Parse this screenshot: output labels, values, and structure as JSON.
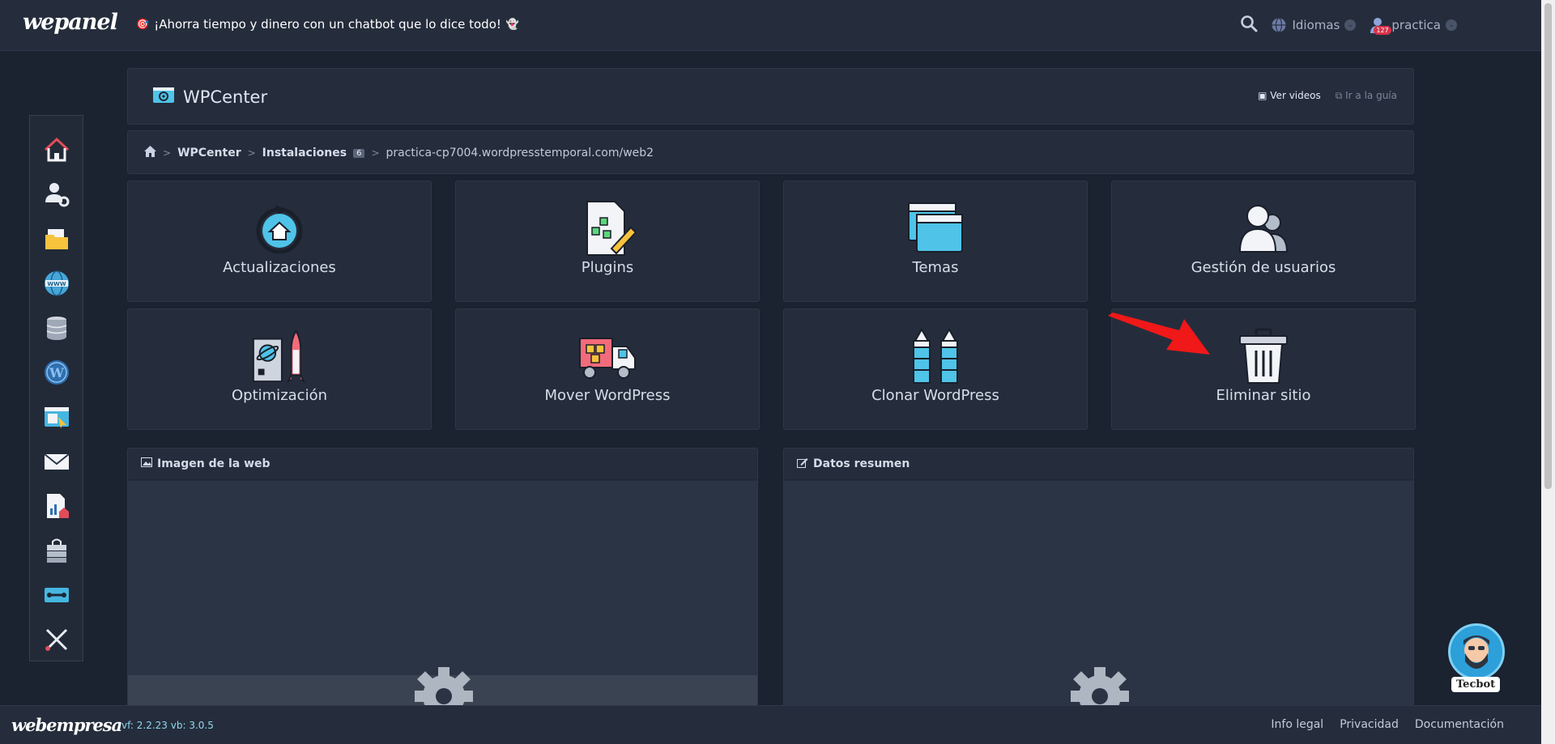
{
  "topbar": {
    "logo": "wepanel",
    "promo_text": "¡Ahorra tiempo y dinero con un chatbot que lo dice todo!",
    "languages_label": "Idiomas",
    "user_label": "practica",
    "notification_count": "127"
  },
  "header": {
    "title": "WPCenter",
    "watch_videos": "Ver videos",
    "go_to_guide": "Ir a la guía"
  },
  "breadcrumb": {
    "wpcenter": "WPCenter",
    "installations": "Instalaciones",
    "installations_count": "6",
    "current": "practica-cp7004.wordpresstemporal.com/web2"
  },
  "tools": [
    {
      "label": "Actualizaciones",
      "icon": "update-icon"
    },
    {
      "label": "Plugins",
      "icon": "plugins-icon"
    },
    {
      "label": "Temas",
      "icon": "themes-icon"
    },
    {
      "label": "Gestión de usuarios",
      "icon": "users-icon"
    },
    {
      "label": "Optimización",
      "icon": "optimization-icon"
    },
    {
      "label": "Mover WordPress",
      "icon": "truck-icon"
    },
    {
      "label": "Clonar WordPress",
      "icon": "clone-icon"
    },
    {
      "label": "Eliminar sitio",
      "icon": "trash-icon"
    }
  ],
  "panels": {
    "web_image_title": "Imagen de la web",
    "summary_title": "Datos resumen"
  },
  "footer": {
    "logo": "webempresa",
    "version": "vf: 2.2.23 vb: 3.0.5",
    "legal": "Info legal",
    "privacy": "Privacidad",
    "docs": "Documentación"
  },
  "chatbot": {
    "label": "Tecbot"
  },
  "colors": {
    "background": "#1b2230",
    "panel": "#252d3c",
    "arrow": "#f01818",
    "accent": "#4fc3e8"
  }
}
